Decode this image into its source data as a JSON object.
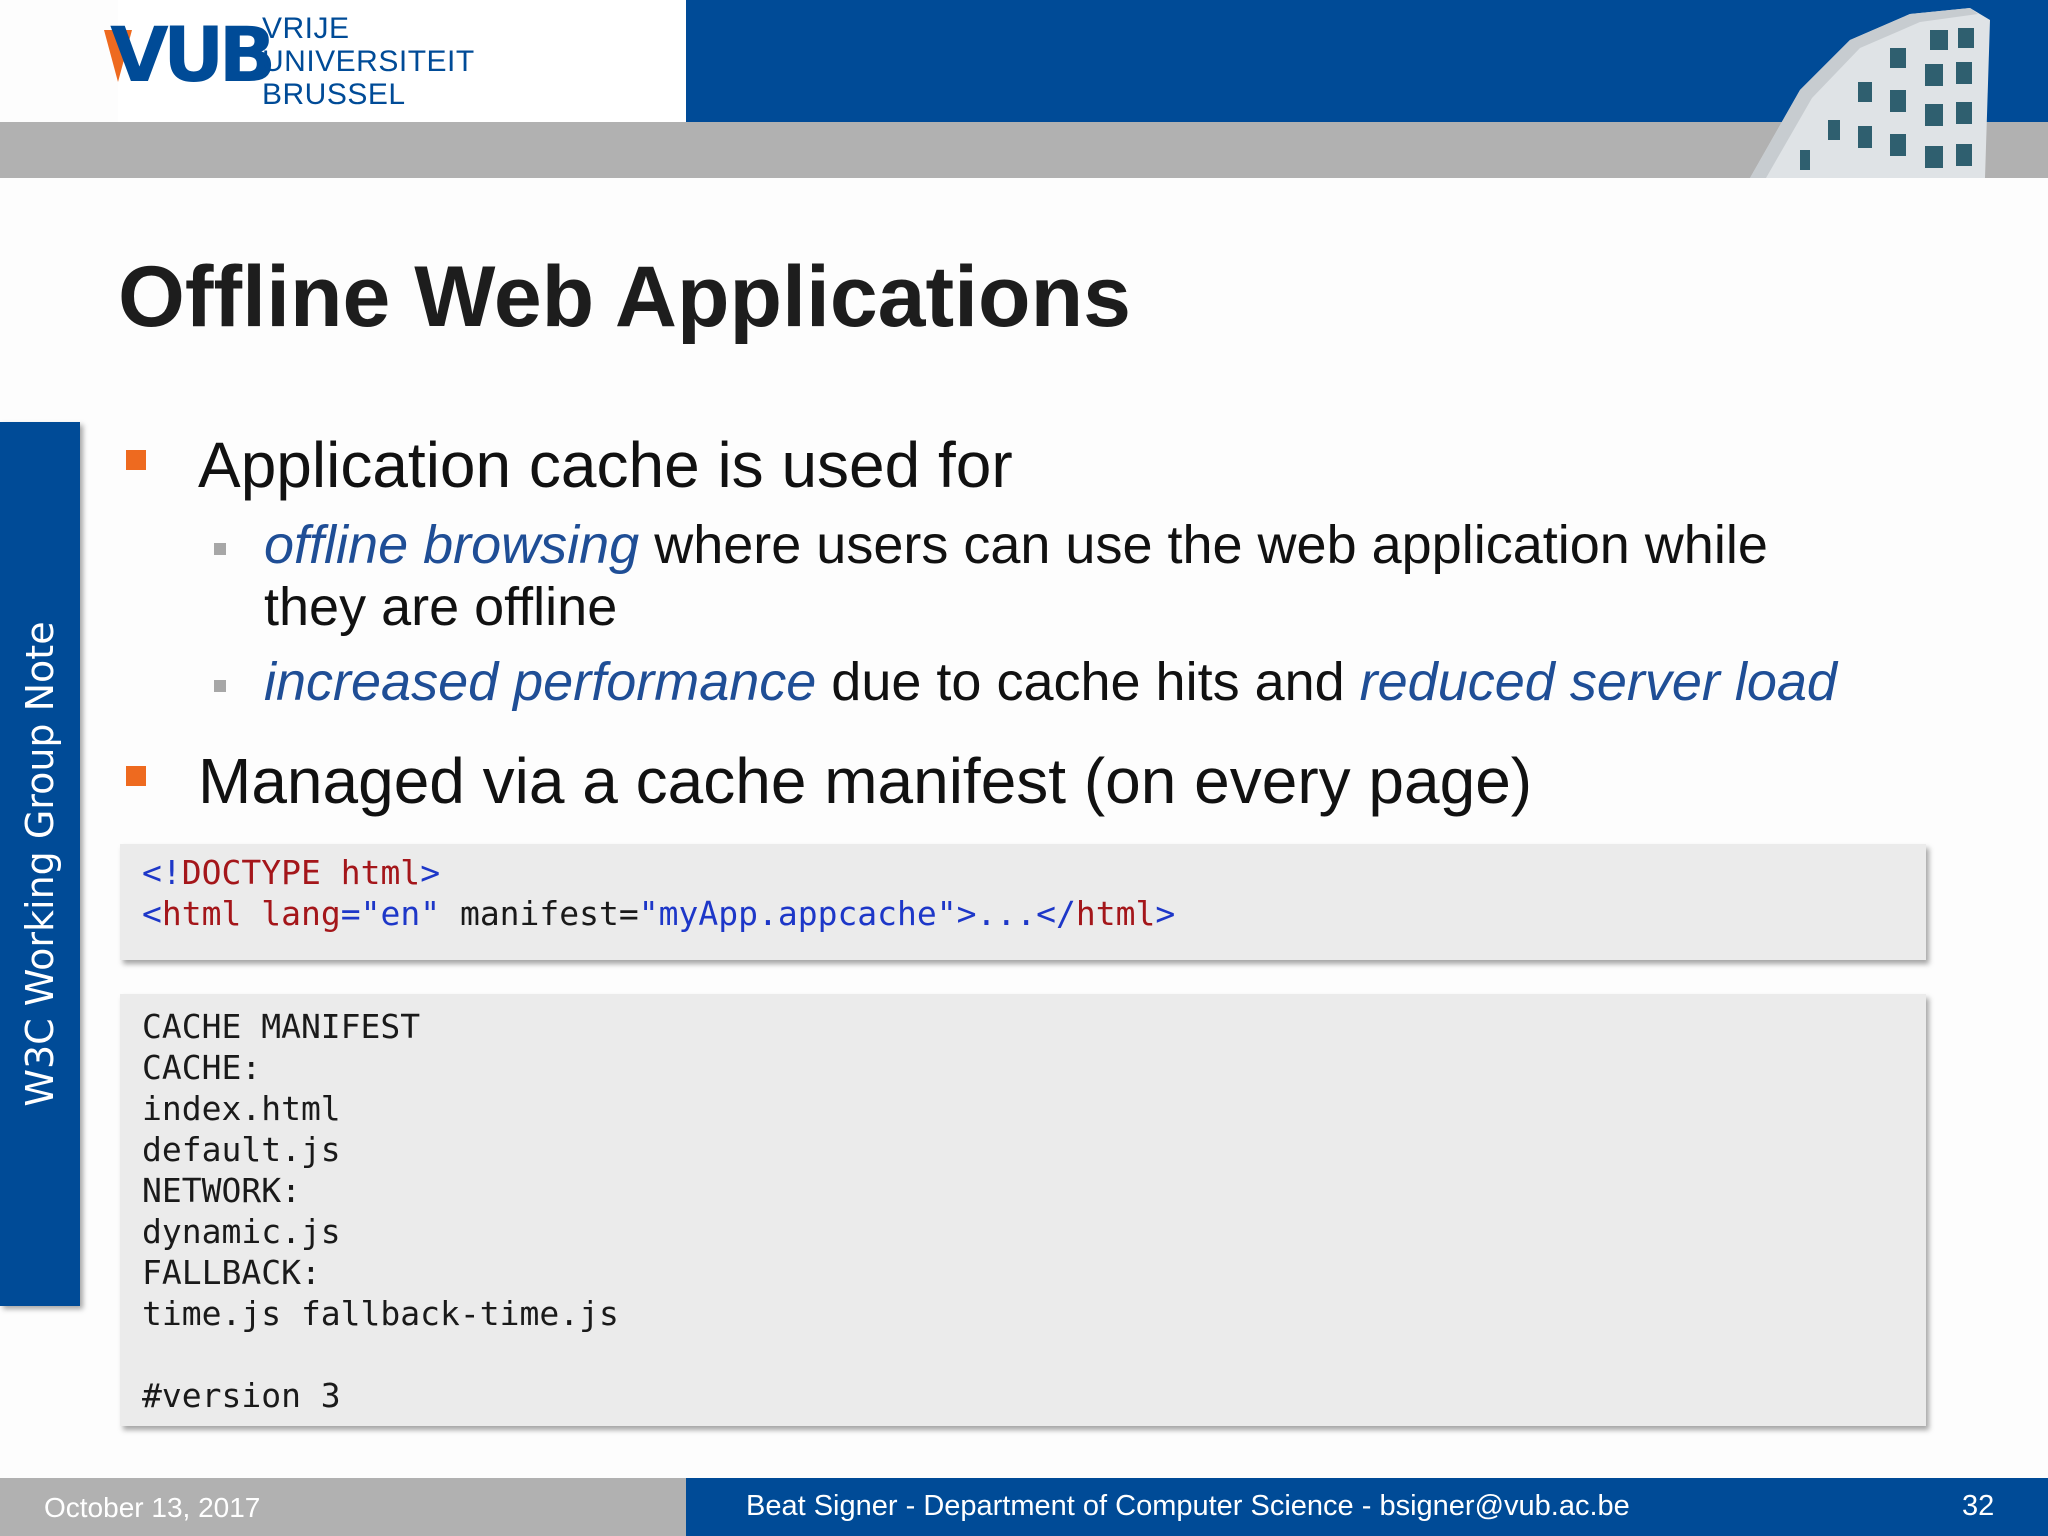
{
  "header": {
    "logo_mark": "VUB",
    "logo_lines": [
      "VRIJE",
      "UNIVERSITEIT",
      "BRUSSEL"
    ]
  },
  "side_tab": {
    "label": "W3C Working Group Note"
  },
  "slide": {
    "title": "Offline Web Applications",
    "bullets": [
      {
        "text": "Application cache is used for",
        "sub": [
          {
            "emph": "offline browsing",
            "rest_line1": " where users can use the web application while",
            "rest_line2": "they are offline"
          },
          {
            "emph1": "increased performance",
            "middle": " due to cache hits and ",
            "emph2": "reduced server load"
          }
        ]
      },
      {
        "text": "Managed via a cache manifest (on every page)"
      }
    ],
    "code_html": {
      "line1": {
        "open": "<!",
        "doctype": "DOCTYPE",
        "sp": " ",
        "html": "html",
        "close": ">"
      },
      "line2": {
        "lt": "<",
        "tag": "html",
        "sp1": " ",
        "attr1": "lang",
        "eq1": "=",
        "val1": "\"en\"",
        "sp2": " manifest",
        "eq2": "=",
        "val2": "\"myApp.appcache\"",
        "gt": ">...</",
        "endtag": "html",
        "end": ">"
      }
    },
    "code_manifest": [
      "CACHE MANIFEST",
      "CACHE:",
      "index.html",
      "default.js",
      "NETWORK:",
      "dynamic.js",
      "FALLBACK:",
      "time.js fallback-time.js",
      "",
      "#version 3"
    ]
  },
  "footer": {
    "date": "October 13, 2017",
    "author": "Beat Signer - Department of Computer Science - bsigner@vub.ac.be",
    "page": "32"
  },
  "colors": {
    "brand_blue": "#004b97",
    "accent_orange": "#ee6a1f",
    "emphasis_blue": "#1f4e96",
    "header_gray": "#b1b1b1",
    "code_bg": "#ebebeb"
  }
}
